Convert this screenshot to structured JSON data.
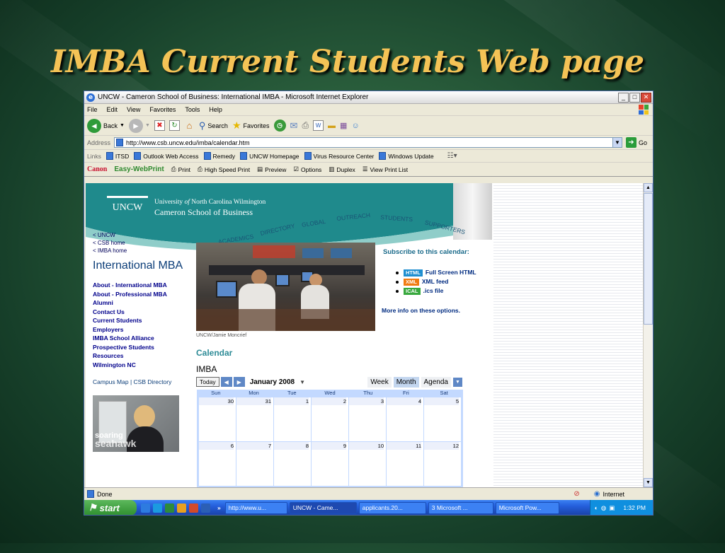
{
  "slide": {
    "title": "IMBA Current Students Web page"
  },
  "window": {
    "title": "UNCW - Cameron School of Business: International IMBA - Microsoft Internet Explorer",
    "ie_glyph": "e",
    "controls": {
      "minimize": "_",
      "maximize": "□",
      "close": "✕"
    }
  },
  "menu": [
    "File",
    "Edit",
    "View",
    "Favorites",
    "Tools",
    "Help"
  ],
  "toolbar": {
    "back": "Back",
    "search": "Search",
    "favorites": "Favorites"
  },
  "address": {
    "label": "Address",
    "url": "http://www.csb.uncw.edu/imba/calendar.htm",
    "go": "Go"
  },
  "links": {
    "label": "Links",
    "items": [
      "ITSD",
      "Outlook Web Access",
      "Remedy",
      "UNCW Homepage",
      "Virus Resource Center",
      "Windows Update"
    ]
  },
  "canon": {
    "brand": "Canon",
    "product": "Easy-WebPrint",
    "buttons": [
      "Print",
      "High Speed Print",
      "Preview",
      "Options",
      "Duplex",
      "View Print List"
    ]
  },
  "page": {
    "logo": "UNCW",
    "university_line": {
      "pre": "University ",
      "em": "of",
      "post": " North Carolina Wilmington"
    },
    "school": "Cameron School of Business",
    "nav_tabs": [
      "ACADEMICS",
      "DIRECTORY",
      "GLOBAL",
      "OUTREACH",
      "STUDENTS",
      "SUPPORTERS"
    ],
    "breadcrumbs": [
      "< UNCW",
      "< CSB home",
      "< IMBA home"
    ],
    "section_title": "International MBA",
    "sidebar_links": [
      "About - International MBA",
      "About - Professional MBA",
      "Alumni",
      "Contact Us",
      "Current Students",
      "Employers",
      "IMBA School Alliance",
      "Prospective Students",
      "Resources",
      "Wilmington NC"
    ],
    "campus_map": "Campus Map",
    "csb_directory": "CSB Directory",
    "soaring": {
      "line1": "soaring",
      "line2": "seahawk"
    },
    "photo_credit": "UNCW/Jamie Moncrief",
    "calendar_heading": "Calendar",
    "subscribe": {
      "title": "Subscribe to this calendar:",
      "items": [
        {
          "badge": "HTML",
          "text": "Full Screen HTML",
          "color": "#1f8fd0"
        },
        {
          "badge": "XML",
          "text": "XML feed",
          "color": "#f07b12"
        },
        {
          "badge": "ICAL",
          "text": ".ics file",
          "color": "#38a83e"
        }
      ],
      "more": "More info on these options."
    },
    "calendar": {
      "title": "IMBA",
      "today": "Today",
      "month": "January 2008",
      "views": [
        "Week",
        "Month",
        "Agenda"
      ],
      "days": [
        "Sun",
        "Mon",
        "Tue",
        "Wed",
        "Thu",
        "Fri",
        "Sat"
      ],
      "weeks": [
        [
          "30",
          "31",
          "1",
          "2",
          "3",
          "4",
          "5"
        ],
        [
          "6",
          "7",
          "8",
          "9",
          "10",
          "11",
          "12"
        ]
      ]
    }
  },
  "status": {
    "left": "Done",
    "zone": "Internet"
  },
  "taskbar": {
    "start": "start",
    "tasks": [
      "http://www.u...",
      "UNCW - Came...",
      "applicants.20...",
      "3 Microsoft ...",
      "Microsoft Pow..."
    ],
    "clock": "1:32 PM"
  },
  "colors": {
    "teal": "#1f8a8c",
    "brand_green": "#2f8a2f",
    "slide_title": "#f4c356"
  }
}
